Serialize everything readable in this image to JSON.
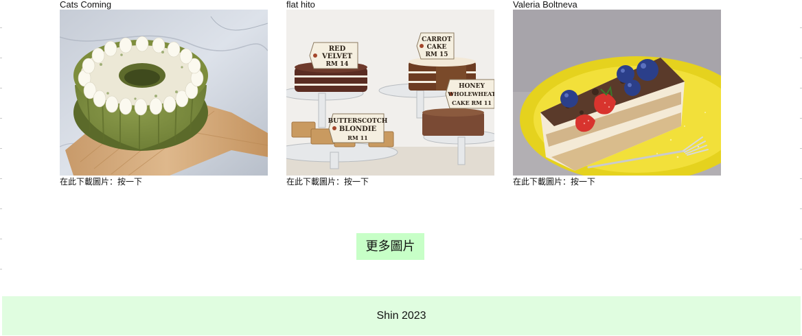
{
  "gallery": {
    "items": [
      {
        "author": "Cats Coming",
        "photo_icon": "matcha-bundt-cake-photo",
        "download_label": "在此下載圖片：按一下"
      },
      {
        "author": "flat hito",
        "photo_icon": "bakery-cake-stands-photo",
        "tags": [
          {
            "lines": [
              "RED",
              "VELVET",
              "RM 14"
            ]
          },
          {
            "lines": [
              "CARROT",
              "CAKE",
              "RM 15"
            ]
          },
          {
            "lines": [
              "HONEY",
              "WHOLEWHEAT",
              "CAKE   RM 11"
            ]
          },
          {
            "lines": [
              "BUTTERSCOTCH",
              "BLONDIE",
              "RM 11"
            ]
          }
        ],
        "download_label": "在此下載圖片：按一下"
      },
      {
        "author": "Valeria Boltneva",
        "photo_icon": "tiramisu-blueberry-photo",
        "download_label": "在此下載圖片：按一下"
      }
    ]
  },
  "more_button": {
    "label": "更多圖片"
  },
  "footer": {
    "text": "Shin 2023"
  },
  "colors": {
    "more_button_bg": "#c7ffc7",
    "footer_bg": "#e0fde0"
  }
}
